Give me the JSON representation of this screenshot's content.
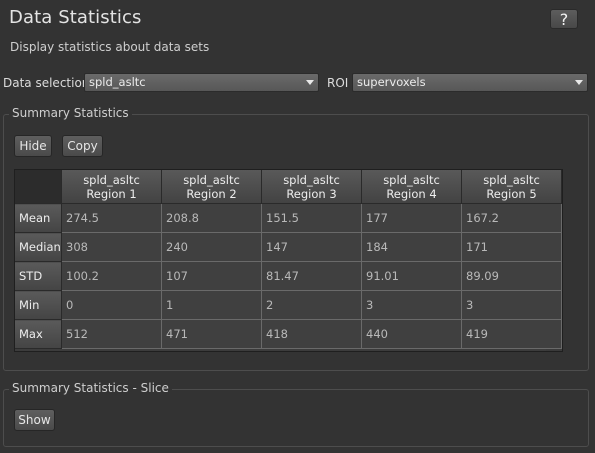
{
  "header": {
    "title": "Data Statistics",
    "help_label": "?",
    "subtitle": "Display statistics about data sets"
  },
  "selection": {
    "data_label": "Data selection",
    "data_value": "spld_asltc",
    "roi_label": "ROI",
    "roi_value": "supervoxels"
  },
  "summary": {
    "group_title": "Summary Statistics",
    "hide_label": "Hide",
    "copy_label": "Copy",
    "columns": [
      {
        "line1": "spld_asltc",
        "line2": "Region 1"
      },
      {
        "line1": "spld_asltc",
        "line2": "Region 2"
      },
      {
        "line1": "spld_asltc",
        "line2": "Region 3"
      },
      {
        "line1": "spld_asltc",
        "line2": "Region 4"
      },
      {
        "line1": "spld_asltc",
        "line2": "Region 5"
      }
    ],
    "rows": [
      {
        "label": "Mean",
        "values": [
          "274.5",
          "208.8",
          "151.5",
          "177",
          "167.2"
        ]
      },
      {
        "label": "Median",
        "values": [
          "308",
          "240",
          "147",
          "184",
          "171"
        ]
      },
      {
        "label": "STD",
        "values": [
          "100.2",
          "107",
          "81.47",
          "91.01",
          "89.09"
        ]
      },
      {
        "label": "Min",
        "values": [
          "0",
          "1",
          "2",
          "3",
          "3"
        ]
      },
      {
        "label": "Max",
        "values": [
          "512",
          "471",
          "418",
          "440",
          "419"
        ]
      }
    ]
  },
  "slice": {
    "group_title": "Summary Statistics - Slice",
    "show_label": "Show"
  }
}
